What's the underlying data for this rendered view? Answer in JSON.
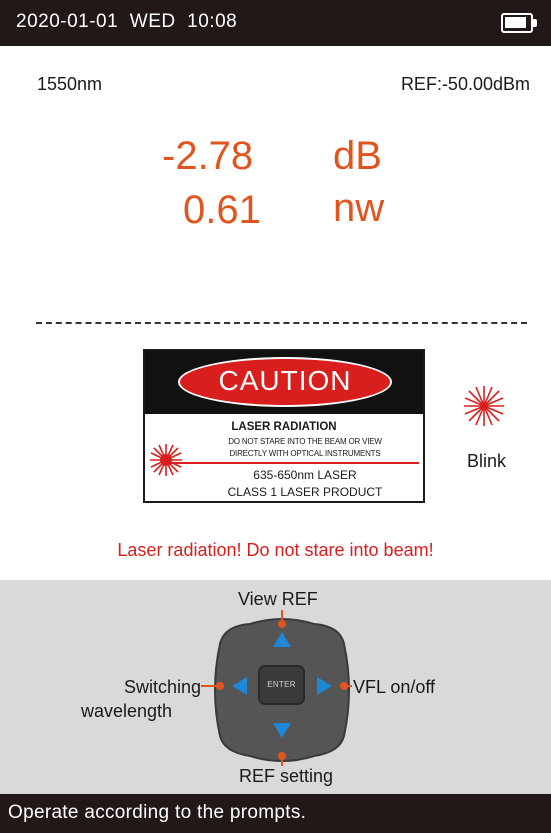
{
  "status_bar": {
    "date": "2020-01-01",
    "weekday": "WED",
    "time": "10:08",
    "battery_icon": "battery-full-icon"
  },
  "measurement": {
    "wavelength": "1550nm",
    "reference": "REF:-50.00dBm",
    "loss_value": "-2.78",
    "loss_unit": "dB",
    "power_value": "0.61",
    "power_unit": "nw"
  },
  "caution_label": {
    "header": "CAUTION",
    "heading": "LASER RADIATION",
    "line1": "DO NOT STARE INTO THE BEAM OR VIEW",
    "line2": "DIRECTLY WITH OPTICAL INSTRUMENTS",
    "spec": "635-650nm LASER",
    "class_text": "CLASS 1 LASER PRODUCT"
  },
  "blink": {
    "label": "Blink"
  },
  "warning": "Laser radiation! Do not stare into beam!",
  "keypad": {
    "up_label": "View REF",
    "left_label_line1": "Switching",
    "left_label_line2": "wavelength",
    "right_label": "VFL on/off",
    "down_label": "REF setting",
    "enter_label": "ENTER"
  },
  "prompt": "Operate according to the prompts.",
  "colors": {
    "reading": "#e0551f",
    "warning": "#d91e1e",
    "bar": "#231818",
    "arrow": "#1e88d6",
    "leader": "#e0551f"
  }
}
